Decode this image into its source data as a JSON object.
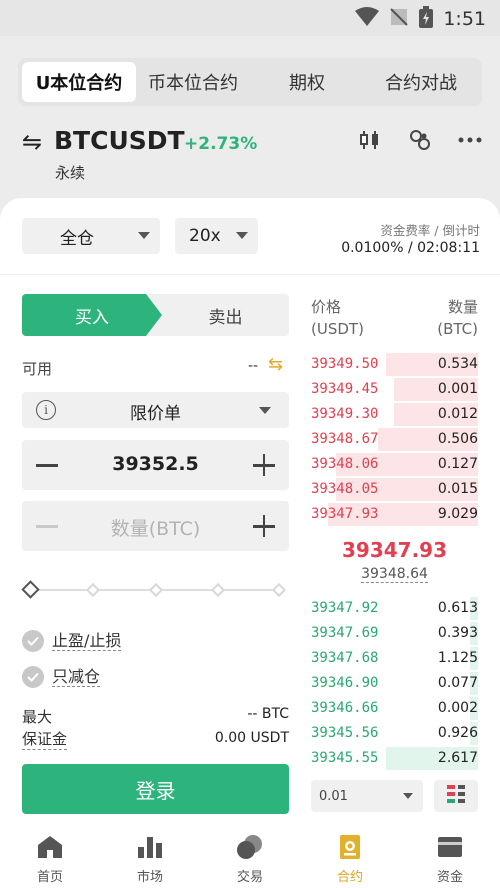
{
  "status_bar": {
    "time": "1:51"
  },
  "tabs": [
    {
      "label": "U本位合约",
      "active": true
    },
    {
      "label": "币本位合约",
      "active": false
    },
    {
      "label": "期权",
      "active": false
    },
    {
      "label": "合约对战",
      "active": false
    }
  ],
  "header": {
    "swap_icon": "⇋",
    "pair": "BTCUSDT",
    "change": "+2.73%",
    "subtitle": "永续"
  },
  "controls": {
    "margin_mode": "全仓",
    "leverage": "20x",
    "funding_label": "资金费率 / 倒计时",
    "funding_value": "0.0100% / 02:08:11"
  },
  "order_form": {
    "buy_label": "买入",
    "sell_label": "卖出",
    "available_label": "可用",
    "available_value": "--",
    "order_type": "限价单",
    "price_value": "39352.5",
    "amount_placeholder": "数量(BTC)",
    "tp_sl_label": "止盈/止损",
    "reduce_only_label": "只减仓",
    "max_label": "最大",
    "max_value": "-- BTC",
    "margin_label": "保证金",
    "margin_value": "0.00 USDT",
    "login_label": "登录"
  },
  "order_book": {
    "price_header_1": "价格",
    "price_header_2": "(USDT)",
    "qty_header_1": "数量",
    "qty_header_2": "(BTC)",
    "asks": [
      {
        "price": "39349.50",
        "qty": "0.534",
        "depth": 0.55
      },
      {
        "price": "39349.45",
        "qty": "0.001",
        "depth": 0.5
      },
      {
        "price": "39349.30",
        "qty": "0.012",
        "depth": 0.5
      },
      {
        "price": "39348.67",
        "qty": "0.506",
        "depth": 0.6
      },
      {
        "price": "39348.06",
        "qty": "0.127",
        "depth": 0.85
      },
      {
        "price": "39348.05",
        "qty": "0.015",
        "depth": 0.85
      },
      {
        "price": "39347.93",
        "qty": "9.029",
        "depth": 0.9
      }
    ],
    "last_price": "39347.93",
    "mark_price": "39348.64",
    "bids": [
      {
        "price": "39347.92",
        "qty": "0.613",
        "depth": 0.05
      },
      {
        "price": "39347.69",
        "qty": "0.393",
        "depth": 0.05
      },
      {
        "price": "39347.68",
        "qty": "1.125",
        "depth": 0.05
      },
      {
        "price": "39346.90",
        "qty": "0.077",
        "depth": 0.05
      },
      {
        "price": "39346.66",
        "qty": "0.002",
        "depth": 0.05
      },
      {
        "price": "39345.56",
        "qty": "0.926",
        "depth": 0.05
      },
      {
        "price": "39345.55",
        "qty": "2.617",
        "depth": 0.55
      }
    ],
    "depth_value": "0.01"
  },
  "nav": [
    {
      "label": "首页",
      "icon": "home-icon",
      "active": false
    },
    {
      "label": "市场",
      "icon": "market-chart-icon",
      "active": false
    },
    {
      "label": "交易",
      "icon": "trade-coins-icon",
      "active": false
    },
    {
      "label": "合约",
      "icon": "futures-icon",
      "active": true
    },
    {
      "label": "资金",
      "icon": "wallet-icon",
      "active": false
    }
  ],
  "colors": {
    "buy_green": "#2db47c",
    "ask_red": "#e0404f",
    "bid_green": "#2aa872",
    "accent_gold": "#d9a520"
  }
}
